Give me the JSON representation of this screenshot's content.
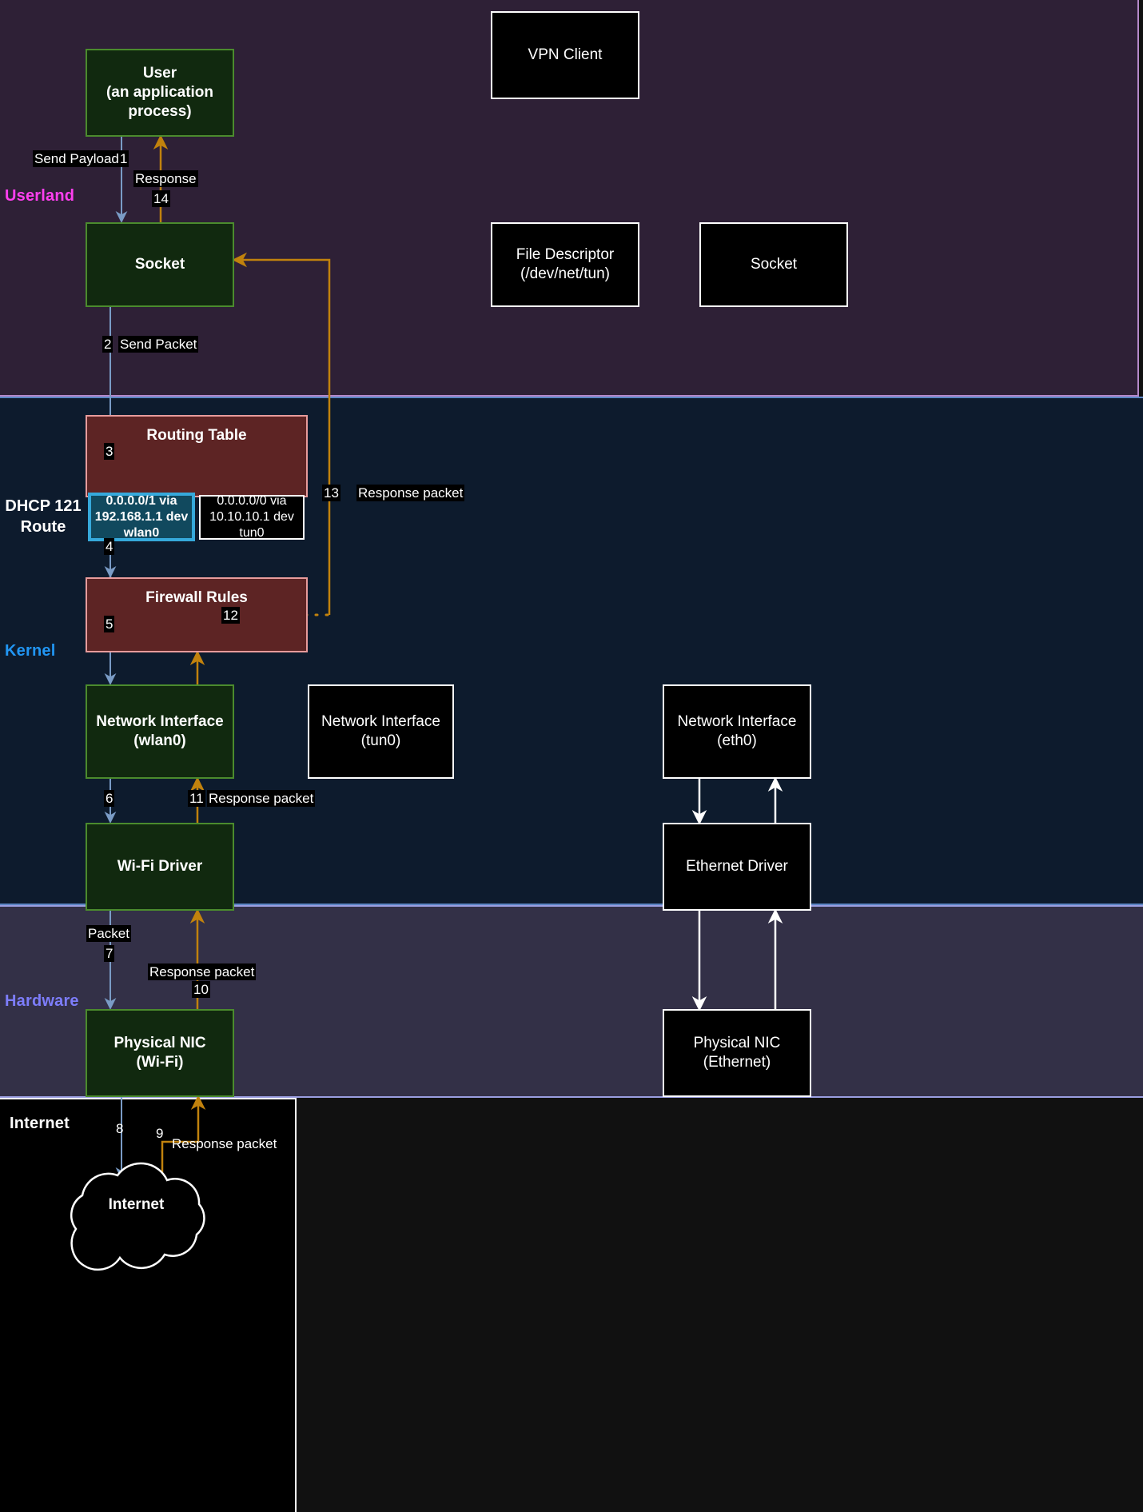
{
  "zones": {
    "userland": "Userland",
    "kernel": "Kernel",
    "hardware": "Hardware",
    "internet": "Internet",
    "dhcp_route": "DHCP 121 Route"
  },
  "colors": {
    "userland_bg": "#2e2036",
    "userland_border": "#b488c9",
    "userland_label": "#ff3ff0",
    "kernel_bg": "#0d1b2d",
    "kernel_border": "#5b85c4",
    "kernel_label": "#2196f3",
    "hardware_bg": "#333047",
    "hardware_border": "#9a9ee0",
    "hardware_label": "#7d7dfb",
    "internet_bg": "#000000",
    "green_node_bg": "#11290f",
    "green_node_border": "#4b8b2d",
    "red_node_bg": "#5d2424",
    "red_node_border": "#e79b9b",
    "selected_route_bg": "#11495e",
    "selected_route_border": "#36a9db",
    "forward_arrow": "#7a9cc6",
    "response_arrow": "#c1820d"
  },
  "nodes": {
    "user": "User\n(an application process)",
    "user_l1": "User",
    "user_l2": "(an application",
    "user_l3": "process)",
    "socket": "Socket",
    "vpn_client": "VPN Client",
    "file_descriptor_l1": "File Descriptor",
    "file_descriptor_l2": "(/dev/net/tun)",
    "socket_vpn": "Socket",
    "routing_table": "Routing Table",
    "route_selected_l1": "0.0.0.0/1 via",
    "route_selected_l2": "192.168.1.1 dev",
    "route_selected_l3": "wlan0",
    "route_alt_l1": "0.0.0.0/0 via",
    "route_alt_l2": "10.10.10.1 dev",
    "route_alt_l3": "tun0",
    "firewall_rules": "Firewall Rules",
    "iface_wlan0_l1": "Network Interface",
    "iface_wlan0_l2": "(wlan0)",
    "iface_tun0_l1": "Network Interface",
    "iface_tun0_l2": "(tun0)",
    "iface_eth0_l1": "Network Interface",
    "iface_eth0_l2": "(eth0)",
    "wifi_driver": "Wi-Fi Driver",
    "ethernet_driver": "Ethernet Driver",
    "nic_wifi_l1": "Physical NIC",
    "nic_wifi_l2": "(Wi-Fi)",
    "nic_eth_l1": "Physical NIC",
    "nic_eth_l2": "(Ethernet)",
    "internet_cloud": "Internet"
  },
  "edges": {
    "e1_label": "Send Payload",
    "e1_num": "1",
    "e2_num": "2",
    "e2_label": "Send Packet",
    "e3_num": "3",
    "e4_num": "4",
    "e5_num": "5",
    "e6_num": "6",
    "e7_label": "Packet",
    "e7_num": "7",
    "e8_num": "8",
    "e9_num": "9",
    "e9_label": "Response packet",
    "e10_label": "Response packet",
    "e10_num": "10",
    "e11_num": "11",
    "e11_label": "Response packet",
    "e12_num": "12",
    "e13_num": "13",
    "e13_label": "Response packet",
    "e14_label": "Response",
    "e14_num": "14"
  }
}
